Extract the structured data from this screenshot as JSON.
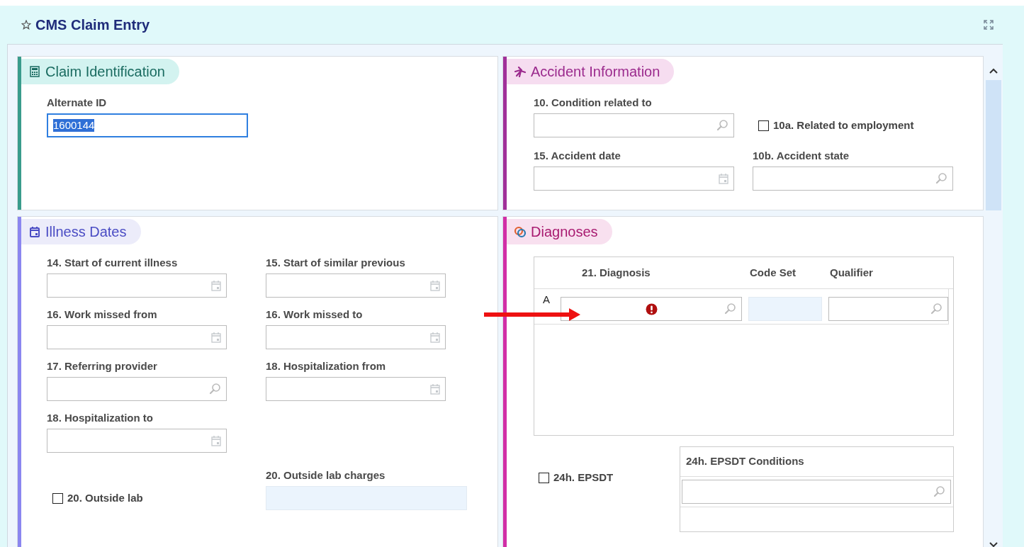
{
  "window": {
    "title": "CMS Claim Entry"
  },
  "sections": [
    {
      "kind": "claim",
      "title": "Claim Identification",
      "fields": [
        {
          "kind": "text",
          "label": "Alternate ID",
          "value": "1600144",
          "focused": true,
          "value_selected": true
        }
      ]
    },
    {
      "kind": "accident",
      "title": "Accident Information",
      "fields": [
        {
          "kind": "lookup",
          "label": "10. Condition related to"
        },
        {
          "kind": "checkbox",
          "label": "10a. Related to employment",
          "checked": false
        },
        {
          "kind": "date",
          "label": "15. Accident date"
        },
        {
          "kind": "lookup",
          "label": "10b. Accident state"
        }
      ]
    },
    {
      "kind": "illness",
      "title": "Illness Dates",
      "fields": [
        {
          "kind": "date",
          "label": "14. Start of current illness"
        },
        {
          "kind": "date",
          "label": "15. Start of similar previous"
        },
        {
          "kind": "date",
          "label": "16. Work missed from"
        },
        {
          "kind": "date",
          "label": "16. Work missed to"
        },
        {
          "kind": "lookup",
          "label": "17. Referring provider"
        },
        {
          "kind": "date",
          "label": "18. Hospitalization from"
        },
        {
          "kind": "date",
          "label": "18. Hospitalization to"
        },
        {
          "kind": "checkbox",
          "label": "20. Outside lab",
          "checked": false
        },
        {
          "kind": "readonly",
          "label": "20. Outside lab charges"
        }
      ]
    },
    {
      "kind": "diagnoses",
      "title": "Diagnoses",
      "table": {
        "columns": [
          "21. Diagnosis",
          "Code Set",
          "Qualifier"
        ],
        "rows": [
          {
            "label": "A",
            "error": true
          }
        ]
      },
      "epsdt": {
        "label": "24h. EPSDT",
        "checked": false
      },
      "conditions": {
        "title": "24h. EPSDT Conditions"
      }
    }
  ]
}
